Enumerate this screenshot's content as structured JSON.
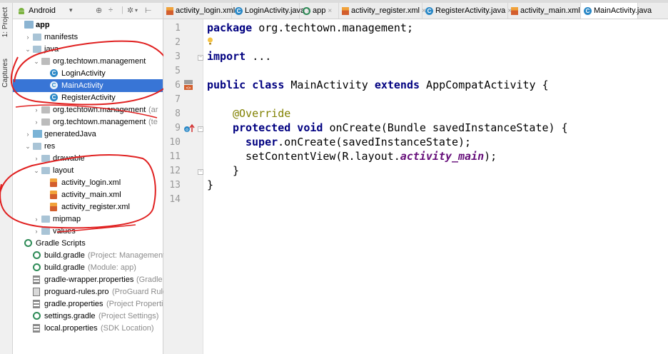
{
  "side_tabs": {
    "project": "1: Project",
    "captures": "Captures"
  },
  "project_view": {
    "label": "Android",
    "caret": "▾"
  },
  "toolbar_icons": [
    "globe-icon",
    "collapse-icon",
    "gear-icon",
    "hide-icon"
  ],
  "tree": [
    {
      "label": "app",
      "hint": "",
      "icon": "app-module-icon",
      "arrow": "",
      "level": 0,
      "bold": true,
      "selected": false
    },
    {
      "label": "manifests",
      "hint": "",
      "icon": "folder-icon",
      "arrow": "›",
      "level": 1
    },
    {
      "label": "java",
      "hint": "",
      "icon": "folder-icon",
      "arrow": "⌄",
      "level": 1
    },
    {
      "label": "org.techtown.management",
      "hint": "",
      "icon": "package-icon",
      "arrow": "⌄",
      "level": 2
    },
    {
      "label": "LoginActivity",
      "hint": "",
      "icon": "class-icon",
      "arrow": "",
      "level": 3
    },
    {
      "label": "MainActivity",
      "hint": "",
      "icon": "class-icon",
      "arrow": "",
      "level": 3,
      "selected": true
    },
    {
      "label": "RegisterActivity",
      "hint": "",
      "icon": "class-icon",
      "arrow": "",
      "level": 3
    },
    {
      "label": "org.techtown.management",
      "hint": "(ar",
      "icon": "package-icon",
      "arrow": "›",
      "level": 2
    },
    {
      "label": "org.techtown.management",
      "hint": "(te",
      "icon": "package-icon",
      "arrow": "›",
      "level": 2
    },
    {
      "label": "generatedJava",
      "hint": "",
      "icon": "generated-folder-icon",
      "arrow": "›",
      "level": 1
    },
    {
      "label": "res",
      "hint": "",
      "icon": "res-folder-icon",
      "arrow": "⌄",
      "level": 1
    },
    {
      "label": "drawable",
      "hint": "",
      "icon": "folder-icon",
      "arrow": "›",
      "level": 2
    },
    {
      "label": "layout",
      "hint": "",
      "icon": "folder-icon",
      "arrow": "⌄",
      "level": 2
    },
    {
      "label": "activity_login.xml",
      "hint": "",
      "icon": "xml-file-icon",
      "arrow": "",
      "level": 3
    },
    {
      "label": "activity_main.xml",
      "hint": "",
      "icon": "xml-file-icon",
      "arrow": "",
      "level": 3
    },
    {
      "label": "activity_register.xml",
      "hint": "",
      "icon": "xml-file-icon",
      "arrow": "",
      "level": 3
    },
    {
      "label": "mipmap",
      "hint": "",
      "icon": "folder-icon",
      "arrow": "›",
      "level": 2
    },
    {
      "label": "values",
      "hint": "",
      "icon": "folder-icon",
      "arrow": "›",
      "level": 2
    },
    {
      "label": "Gradle Scripts",
      "hint": "",
      "icon": "gradle-icon",
      "arrow": "",
      "level": 0
    },
    {
      "label": "build.gradle",
      "hint": "(Project: Management",
      "icon": "gradle-icon",
      "arrow": "",
      "level": 1
    },
    {
      "label": "build.gradle",
      "hint": "(Module: app)",
      "icon": "gradle-icon",
      "arrow": "",
      "level": 1
    },
    {
      "label": "gradle-wrapper.properties",
      "hint": "(Gradle",
      "icon": "properties-icon",
      "arrow": "",
      "level": 1
    },
    {
      "label": "proguard-rules.pro",
      "hint": "(ProGuard Rule",
      "icon": "pro-file-icon",
      "arrow": "",
      "level": 1
    },
    {
      "label": "gradle.properties",
      "hint": "(Project Propertie",
      "icon": "properties-icon",
      "arrow": "",
      "level": 1
    },
    {
      "label": "settings.gradle",
      "hint": "(Project Settings)",
      "icon": "gradle-icon",
      "arrow": "",
      "level": 1
    },
    {
      "label": "local.properties",
      "hint": "(SDK Location)",
      "icon": "properties-icon",
      "arrow": "",
      "level": 1
    }
  ],
  "tabs": [
    {
      "label": "activity_login.xml",
      "icon": "xml"
    },
    {
      "label": "LoginActivity.java",
      "icon": "class"
    },
    {
      "label": "app",
      "icon": "gradle"
    },
    {
      "label": "activity_register.xml",
      "icon": "xml"
    },
    {
      "label": "RegisterActivity.java",
      "icon": "class"
    },
    {
      "label": "activity_main.xml",
      "icon": "xml"
    },
    {
      "label": "MainActivity.java",
      "icon": "class",
      "active": true
    }
  ],
  "tab_close": "×",
  "line_numbers": [
    "1",
    "2",
    "3",
    "5",
    "6",
    "7",
    "8",
    "9",
    "10",
    "11",
    "12",
    "13",
    "14"
  ],
  "code": {
    "l1_kw": "package",
    "l1_rest": " org.techtown.management;",
    "l3_kw": "import",
    "l3_rest": " ...",
    "l6_kw1": "public class",
    "l6_mid": " MainActivity ",
    "l6_kw2": "extends",
    "l6_rest": " AppCompatActivity {",
    "l8_ann": "@Override",
    "l9_kw": "protected void",
    "l9_rest": " onCreate(Bundle savedInstanceState) {",
    "l10_kw": "super",
    "l10_rest": ".onCreate(savedInstanceState);",
    "l11_pre": "setContentView(R.layout.",
    "l11_field": "activity_main",
    "l11_post": ");",
    "l12": "}",
    "l13": "}"
  },
  "colors": {
    "selection": "#3875d6",
    "keyword": "#000080",
    "annotation": "#808000",
    "field": "#660e7a",
    "annotation_ink": "#e02020"
  }
}
